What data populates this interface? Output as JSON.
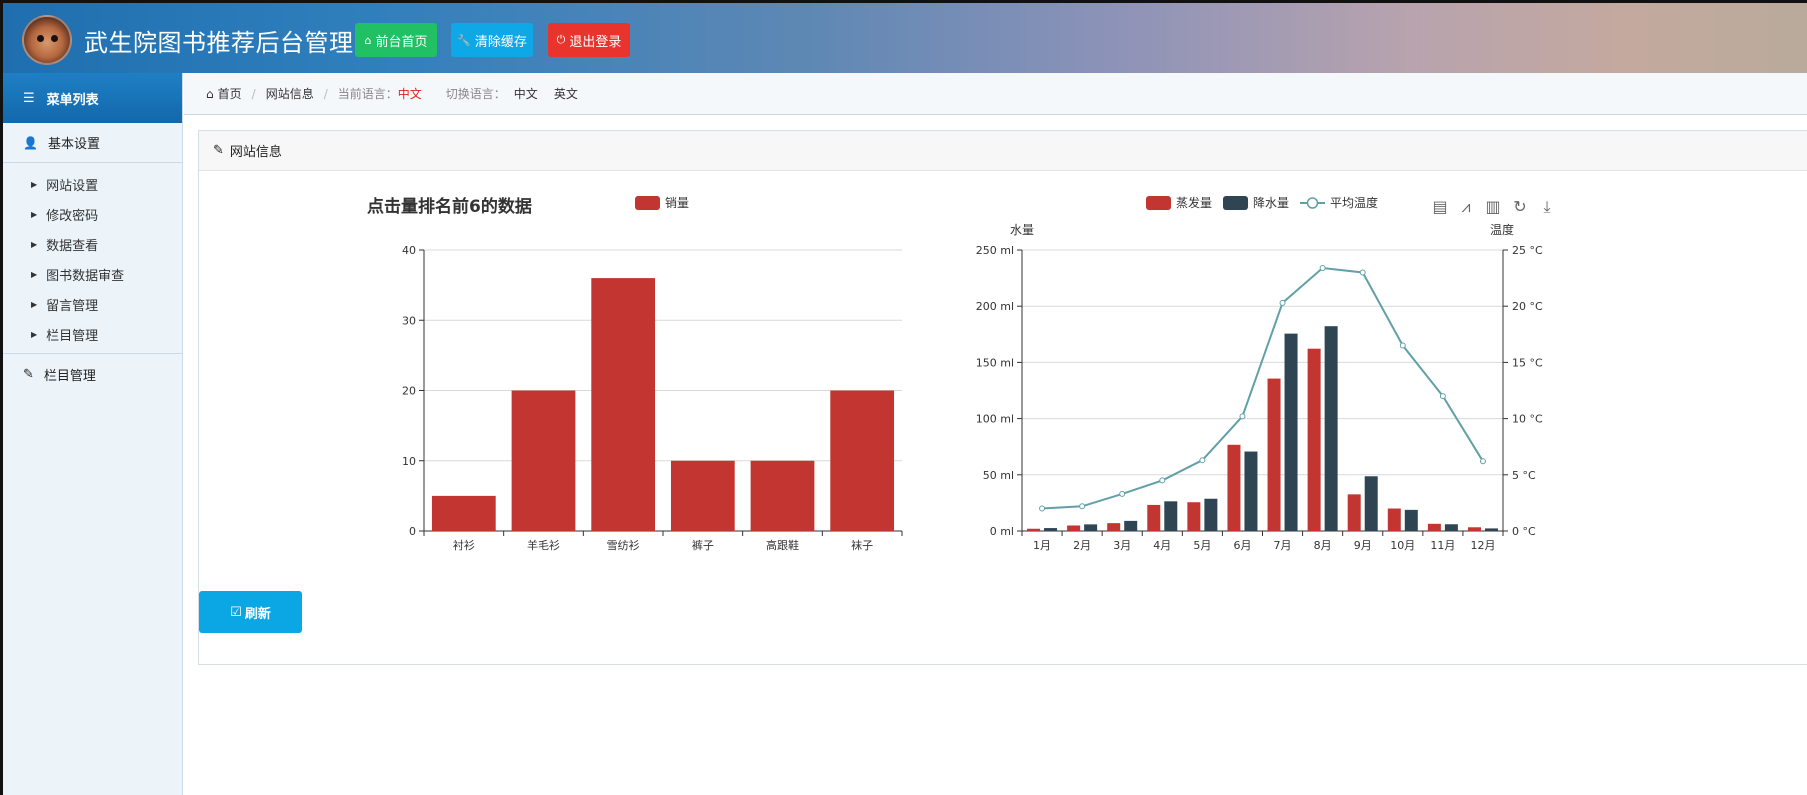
{
  "header": {
    "title": "武生院图书推荐后台管理中心",
    "buttons": [
      {
        "label": "前台首页",
        "icon": "home-icon",
        "color": "#21c064"
      },
      {
        "label": "清除缓存",
        "icon": "wrench-icon",
        "color": "#0ea8e6"
      },
      {
        "label": "退出登录",
        "icon": "power-icon",
        "color": "#e8342c"
      }
    ]
  },
  "sidebar": {
    "menu_title": "菜单列表",
    "group1": "基本设置",
    "items": [
      "网站设置",
      "修改密码",
      "数据查看",
      "图书数据审查",
      "留言管理",
      "栏目管理"
    ],
    "group2": "栏目管理"
  },
  "breadcrumb": {
    "home": "首页",
    "page": "网站信息",
    "current_lang_label": "当前语言：",
    "current_lang": "中文",
    "switch_label": "切换语言：",
    "lang_zh": "中文",
    "lang_en": "英文"
  },
  "panel": {
    "title": "网站信息",
    "refresh_label": "刷新"
  },
  "chart_data": [
    {
      "type": "bar",
      "title": "点击量排名前6的数据",
      "legend": "top",
      "categories": [
        "衬衫",
        "羊毛衫",
        "雪纺衫",
        "裤子",
        "高跟鞋",
        "袜子"
      ],
      "series": [
        {
          "name": "销量",
          "values": [
            5,
            20,
            36,
            10,
            10,
            20
          ],
          "color": "#c23531"
        }
      ],
      "ylim": [
        0,
        40
      ],
      "yticks": [
        "0",
        "10",
        "20",
        "30",
        "40"
      ],
      "grid": true
    },
    {
      "type": "bar",
      "legend": "top",
      "toolbox": [
        "data-view-icon",
        "line-chart-icon",
        "bar-chart-icon",
        "restore-icon",
        "download-icon"
      ],
      "categories": [
        "1月",
        "2月",
        "3月",
        "4月",
        "5月",
        "6月",
        "7月",
        "8月",
        "9月",
        "10月",
        "11月",
        "12月"
      ],
      "y_left": {
        "label": "水量",
        "ylim": [
          0,
          250
        ],
        "ticks": [
          "0 ml",
          "50 ml",
          "100 ml",
          "150 ml",
          "200 ml",
          "250 ml"
        ]
      },
      "y_right": {
        "label": "温度",
        "ylim": [
          0,
          25
        ],
        "ticks": [
          "0 °C",
          "5 °C",
          "10 °C",
          "15 °C",
          "20 °C",
          "25 °C"
        ]
      },
      "series": [
        {
          "name": "蒸发量",
          "type": "bar",
          "axis": "left",
          "color": "#c23531",
          "values": [
            2.0,
            4.9,
            7.0,
            23.2,
            25.6,
            76.7,
            135.6,
            162.2,
            32.6,
            20.0,
            6.4,
            3.3
          ]
        },
        {
          "name": "降水量",
          "type": "bar",
          "axis": "left",
          "color": "#2f4554",
          "values": [
            2.6,
            5.9,
            9.0,
            26.4,
            28.7,
            70.7,
            175.6,
            182.2,
            48.7,
            18.8,
            6.0,
            2.3
          ]
        },
        {
          "name": "平均温度",
          "type": "line",
          "axis": "right",
          "color": "#61a0a8",
          "values": [
            2.0,
            2.2,
            3.3,
            4.5,
            6.3,
            10.2,
            20.3,
            23.4,
            23.0,
            16.5,
            12.0,
            6.2
          ]
        }
      ],
      "grid": true
    }
  ]
}
